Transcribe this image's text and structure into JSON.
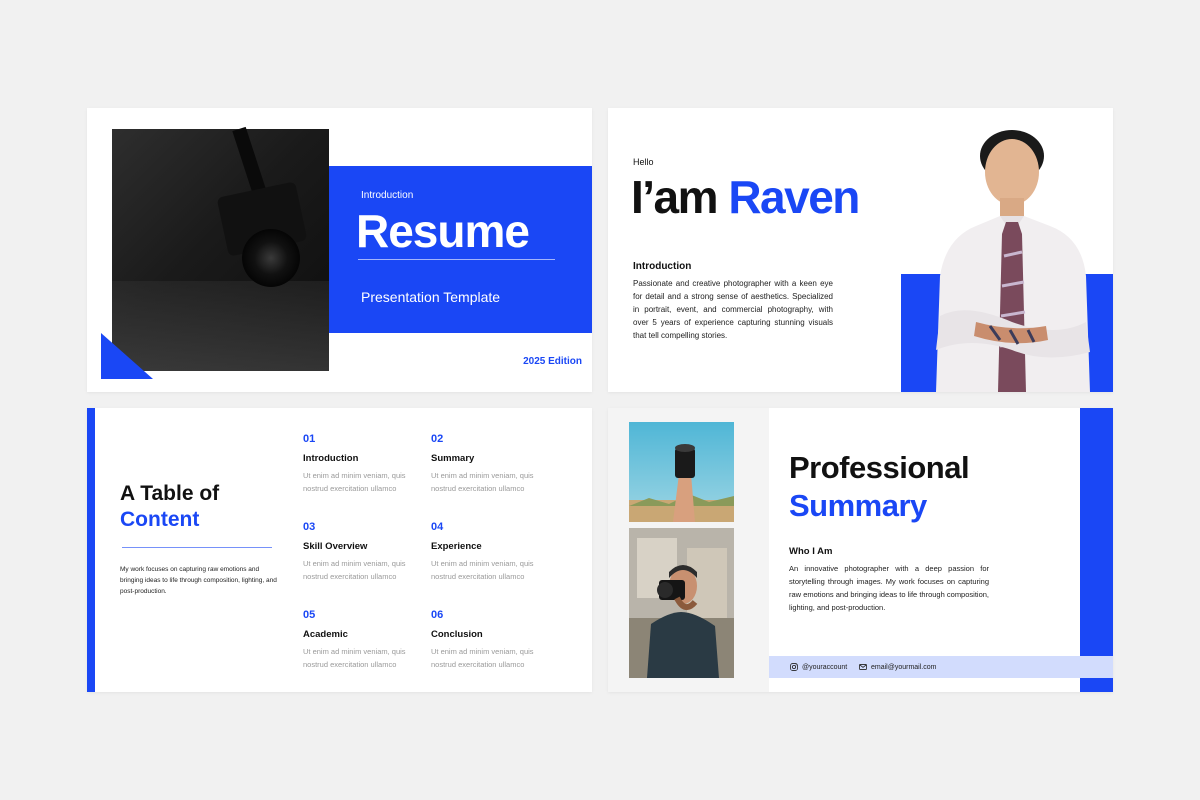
{
  "colors": {
    "accent": "#1a47f5",
    "footer": "#d2dcfd",
    "background": "#f1f1f1"
  },
  "slide1": {
    "intro": "Introduction",
    "title": "Resume",
    "subtitle": "Presentation Template",
    "edition": "2025 Edition"
  },
  "slide2": {
    "hello": "Hello",
    "name_prefix": "I’am ",
    "name": "Raven",
    "heading": "Introduction",
    "paragraph": "Passionate and creative photographer with a keen eye for detail and a strong sense of aesthetics. Specialized in portrait, event, and commercial photography, with over 5 years of experience capturing stunning visuals that tell compelling stories."
  },
  "slide3": {
    "title_line1": "A Table of",
    "title_line2": "Content",
    "description": "My work focuses on capturing raw emotions and bringing ideas to life through composition, lighting, and post-production.",
    "items": [
      {
        "num": "01",
        "title": "Introduction",
        "text": "Ut enim ad minim veniam, quis nostrud exercitation ullamco"
      },
      {
        "num": "02",
        "title": "Summary",
        "text": "Ut enim ad minim veniam, quis nostrud exercitation ullamco"
      },
      {
        "num": "03",
        "title": "Skill Overview",
        "text": "Ut enim ad minim veniam, quis nostrud exercitation ullamco"
      },
      {
        "num": "04",
        "title": "Experience",
        "text": "Ut enim ad minim veniam, quis nostrud exercitation ullamco"
      },
      {
        "num": "05",
        "title": "Academic",
        "text": "Ut enim ad minim veniam, quis nostrud exercitation ullamco"
      },
      {
        "num": "06",
        "title": "Conclusion",
        "text": "Ut enim ad minim veniam, quis nostrud exercitation ullamco"
      }
    ]
  },
  "slide4": {
    "title_line1": "Professional",
    "title_line2": "Summary",
    "heading": "Who I Am",
    "paragraph": "An innovative photographer with a deep passion for storytelling through images. My work focuses on capturing raw emotions and bringing ideas to life through composition, lighting, and post-production.",
    "instagram": "@youraccount",
    "email": "email@yourmail.com",
    "instagram_icon": "instagram-icon",
    "email_icon": "mail-icon"
  }
}
